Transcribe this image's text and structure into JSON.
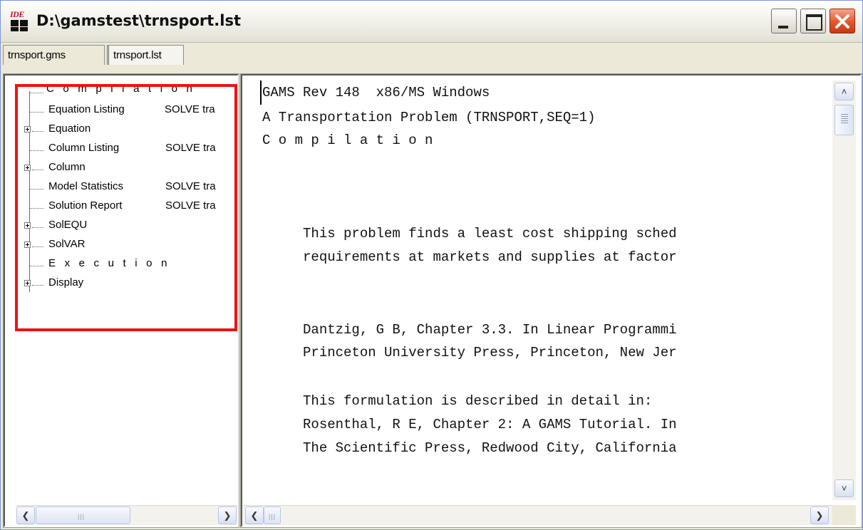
{
  "window": {
    "title": "D:\\gamstest\\trnsport.lst",
    "icon_text": "IDE",
    "icon": "gams-ide-icon"
  },
  "tabs": [
    {
      "label": "trnsport.gms",
      "active": false
    },
    {
      "label": "trnsport.lst",
      "active": true
    }
  ],
  "tree": {
    "items": [
      {
        "label": "C o m p i l a t i o n",
        "extra": "",
        "expandable": false
      },
      {
        "label": "Equation Listing",
        "extra": "SOLVE tra",
        "expandable": false
      },
      {
        "label": "Equation",
        "extra": "",
        "expandable": true
      },
      {
        "label": "Column Listing",
        "extra": "SOLVE tra",
        "expandable": false
      },
      {
        "label": "Column",
        "extra": "",
        "expandable": true
      },
      {
        "label": "Model Statistics",
        "extra": "SOLVE tra",
        "expandable": false
      },
      {
        "label": "Solution Report",
        "extra": "SOLVE tra",
        "expandable": false
      },
      {
        "label": "SolEQU",
        "extra": "",
        "expandable": true
      },
      {
        "label": "SolVAR",
        "extra": "",
        "expandable": true
      },
      {
        "label": "E x e c u t i o n",
        "extra": "",
        "expandable": false
      },
      {
        "label": "Display",
        "extra": "",
        "expandable": true
      }
    ]
  },
  "listing": {
    "lines": [
      "GAMS Rev 148  x86/MS Windows",
      "A Transportation Problem (TRNSPORT,SEQ=1)",
      "C o m p i l a t i o n",
      "",
      "",
      "",
      "     This problem finds a least cost shipping sched",
      "     requirements at markets and supplies at factor",
      "",
      "",
      "",
      "     Dantzig, G B, Chapter 3.3. In Linear Programmi",
      "     Princeton University Press, Princeton, New Jer",
      "",
      "     This formulation is described in detail in:",
      "     Rosenthal, R E, Chapter 2: A GAMS Tutorial. In",
      "     The Scientific Press, Redwood City, California"
    ]
  },
  "colors": {
    "highlight": "#ee1111",
    "close_button": "#e2562b"
  }
}
